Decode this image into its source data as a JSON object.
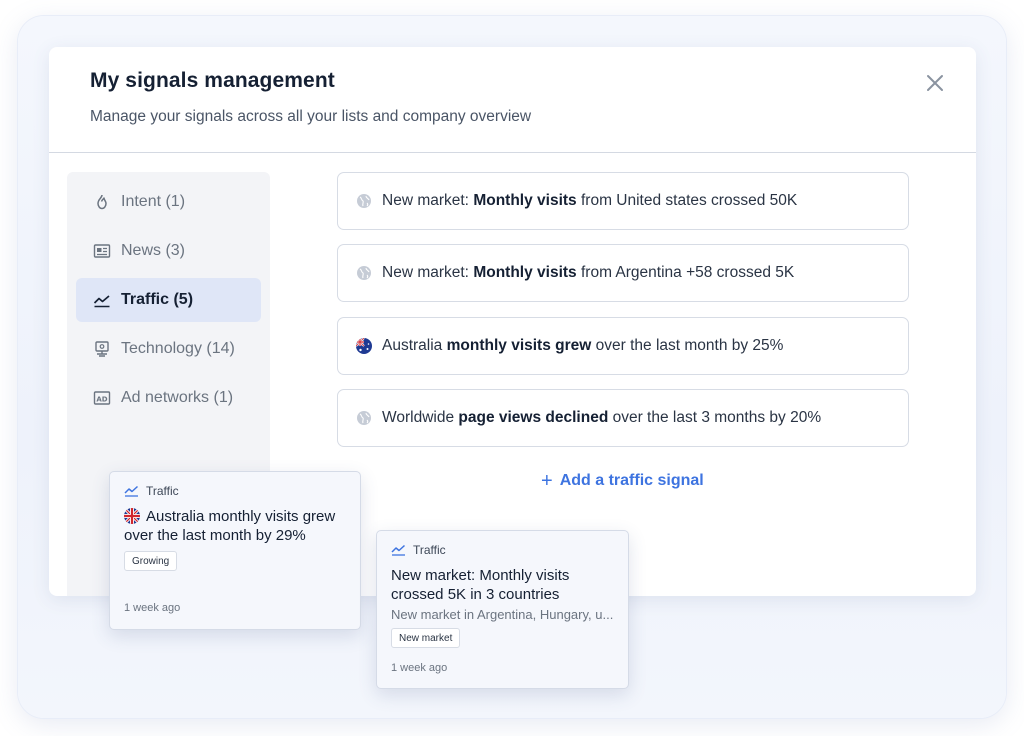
{
  "modal": {
    "title": "My signals management",
    "subtitle": "Manage your signals across all your lists and company overview",
    "close_icon": "close-icon"
  },
  "sidebar": {
    "items": [
      {
        "label": "Intent (1)",
        "icon": "flame-icon",
        "active": false
      },
      {
        "label": "News (3)",
        "icon": "newspaper-icon",
        "active": false
      },
      {
        "label": "Traffic (5)",
        "icon": "trend-line-icon",
        "active": true
      },
      {
        "label": "Technology (14)",
        "icon": "monitor-icon",
        "active": false
      },
      {
        "label": "Ad networks (1)",
        "icon": "ad-icon",
        "active": false
      }
    ]
  },
  "signals": [
    {
      "icon": "globe-icon",
      "prefix": "New market: ",
      "bold": "Monthly visits",
      "suffix": " from United states crossed 50K"
    },
    {
      "icon": "globe-icon",
      "prefix": "New market: ",
      "bold": "Monthly visits",
      "suffix": " from Argentina +58 crossed 5K"
    },
    {
      "icon": "australia-flag-icon",
      "prefix": "Australia ",
      "bold": "monthly visits grew",
      "suffix": " over the last month by 25%"
    },
    {
      "icon": "globe-icon",
      "prefix": "Worldwide ",
      "bold": "page views declined",
      "suffix": " over the last 3 months by 20%"
    }
  ],
  "add_signal": {
    "label": "Add a traffic signal",
    "icon": "plus-icon"
  },
  "floating_cards": [
    {
      "category": "Traffic",
      "title": "Australia monthly visits grew over the last month by 29%",
      "badge": "Growing",
      "time": "1 week ago",
      "flag_icon": "uk-flag-icon"
    },
    {
      "category": "Traffic",
      "title": "New market: Monthly visits crossed 5K in 3 countries",
      "description": "New market in Argentina, Hungary, u...",
      "badge": "New market",
      "time": "1 week ago"
    }
  ],
  "colors": {
    "accent": "#3e74e0",
    "active_bg": "#dfe6f7",
    "title": "#152033"
  }
}
